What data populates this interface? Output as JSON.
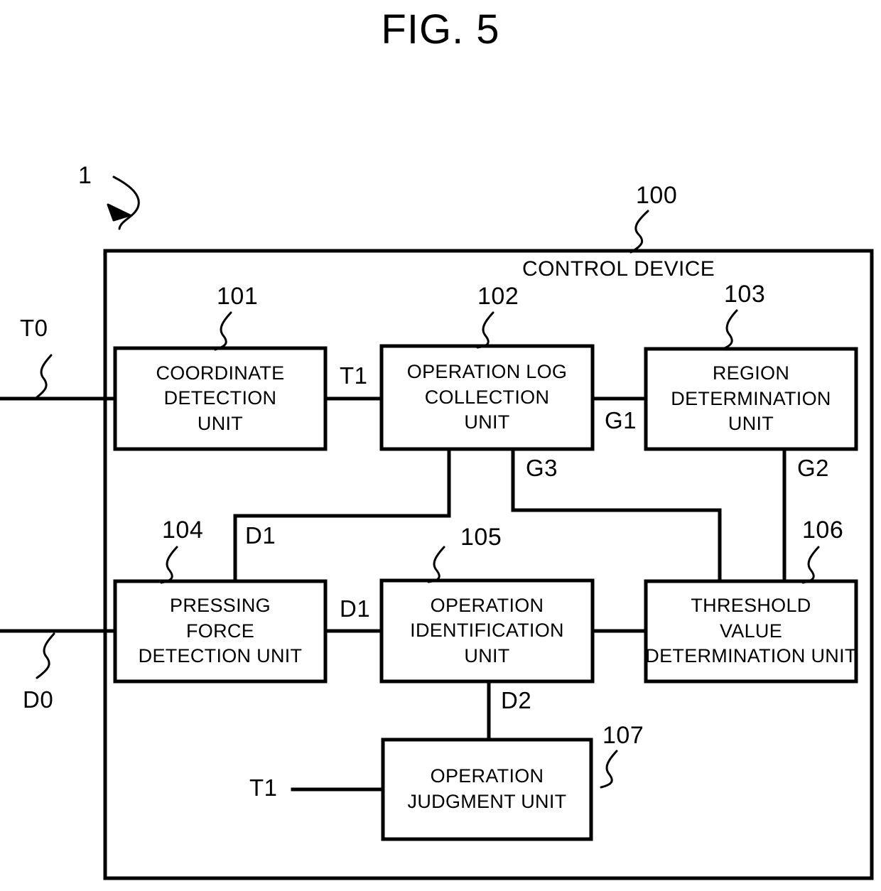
{
  "figure": {
    "title": "FIG. 5",
    "system_ref": "1",
    "device_ref": "100",
    "device_title": "CONTROL DEVICE"
  },
  "blocks": [
    {
      "ref": "101",
      "lines": [
        "COORDINATE",
        "DETECTION",
        "UNIT"
      ],
      "name": "coordinate-detection-unit"
    },
    {
      "ref": "102",
      "lines": [
        "OPERATION LOG",
        "COLLECTION",
        "UNIT"
      ],
      "name": "operation-log-collection-unit"
    },
    {
      "ref": "103",
      "lines": [
        "REGION",
        "DETERMINATION",
        "UNIT"
      ],
      "name": "region-determination-unit"
    },
    {
      "ref": "104",
      "lines": [
        "PRESSING",
        "FORCE",
        "DETECTION UNIT"
      ],
      "name": "pressing-force-detection-unit"
    },
    {
      "ref": "105",
      "lines": [
        "OPERATION",
        "IDENTIFICATION",
        "UNIT"
      ],
      "name": "operation-identification-unit"
    },
    {
      "ref": "106",
      "lines": [
        "THRESHOLD",
        "VALUE",
        "DETERMINATION UNIT"
      ],
      "name": "threshold-value-determination-unit"
    },
    {
      "ref": "107",
      "lines": [
        "OPERATION",
        "JUDGMENT UNIT"
      ],
      "name": "operation-judgment-unit"
    }
  ],
  "signals": {
    "t0": "T0",
    "d0": "D0",
    "t1_a": "T1",
    "t1_b": "T1",
    "g1": "G1",
    "g2": "G2",
    "g3": "G3",
    "d1_a": "D1",
    "d1_b": "D1",
    "d2": "D2"
  },
  "colors": {
    "stroke": "#000000",
    "background": "#ffffff"
  }
}
